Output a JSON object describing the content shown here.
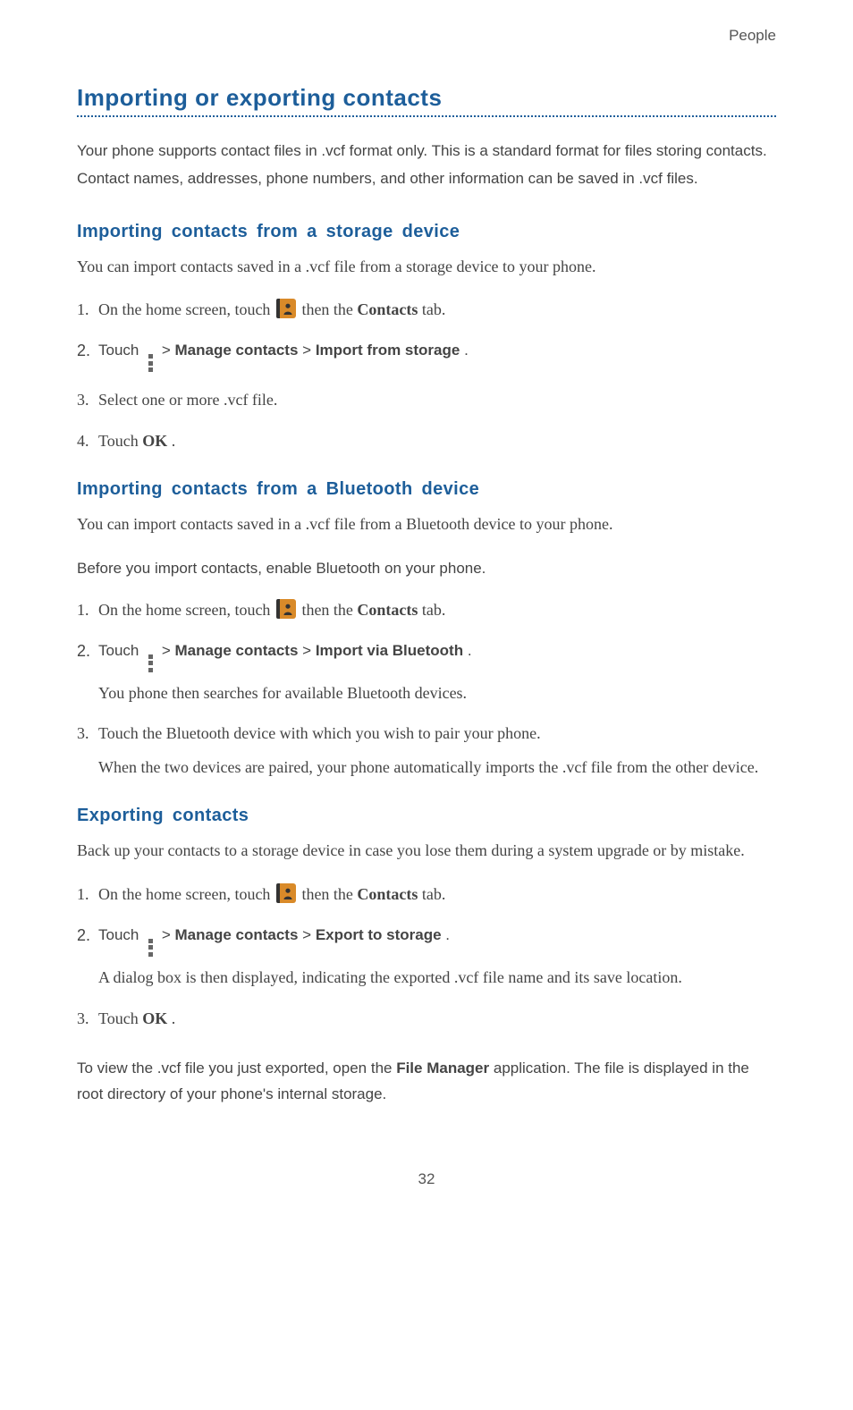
{
  "breadcrumb": "People",
  "page_number": "32",
  "h1": "Importing or exporting contacts",
  "intro": "Your phone supports contact files in .vcf format only. This is a standard format for files storing contacts. Contact names, addresses, phone numbers, and other information can be saved in .vcf files.",
  "sections": {
    "storage": {
      "heading": "Importing contacts from a storage device",
      "intro": "You can import contacts saved in a .vcf file from a storage device to your phone.",
      "step1_a": "On the home screen, touch ",
      "step1_b": " then the ",
      "step1_c": "Contacts",
      "step1_d": " tab.",
      "step2_a": "Touch ",
      "step2_gt1": " > ",
      "step2_b": "Manage contacts",
      "step2_gt2": " > ",
      "step2_c": "Import from storage",
      "step2_d": ".",
      "step3": "Select one or more .vcf file.",
      "step4_a": "Touch ",
      "step4_b": "OK",
      "step4_c": "."
    },
    "bluetooth": {
      "heading": "Importing contacts from a Bluetooth device",
      "intro": "You can import contacts saved in a .vcf file from a Bluetooth device to your phone.",
      "pre": "Before you import contacts, enable Bluetooth on your phone.",
      "step1_a": "On the home screen, touch ",
      "step1_b": " then the ",
      "step1_c": "Contacts",
      "step1_d": " tab.",
      "step2_a": "Touch ",
      "step2_gt1": " > ",
      "step2_b": "Manage contacts",
      "step2_gt2": " > ",
      "step2_c": "Import via Bluetooth",
      "step2_d": ".",
      "step2_sub": "You phone then searches for available Bluetooth devices.",
      "step3": "Touch the Bluetooth device with which you wish to pair your phone.",
      "step3_sub": "When the two devices are paired, your phone automatically imports the .vcf file from the other device."
    },
    "export": {
      "heading": "Exporting contacts",
      "intro": "Back up your contacts to a storage device in case you lose them during a system upgrade or by mistake.",
      "step1_a": "On the home screen, touch ",
      "step1_b": " then the ",
      "step1_c": "Contacts",
      "step1_d": " tab.",
      "step2_a": "Touch ",
      "step2_gt1": " > ",
      "step2_b": "Manage contacts",
      "step2_gt2": " > ",
      "step2_c": "Export to storage",
      "step2_d": ".",
      "step2_sub": "A dialog box is then displayed, indicating the exported .vcf file name and its save location.",
      "step3_a": "Touch ",
      "step3_b": "OK",
      "step3_c": ".",
      "outro_a": "To view the .vcf file you just exported, open the ",
      "outro_b": "File Manager",
      "outro_c": " application. The file is displayed in the root directory of your phone's internal storage."
    }
  }
}
